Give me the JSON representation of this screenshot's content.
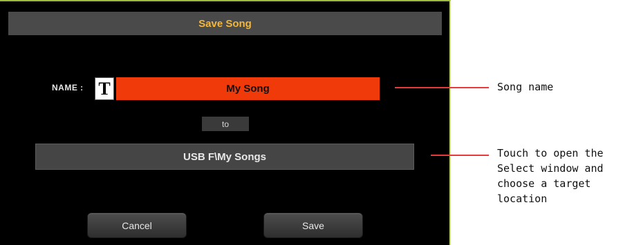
{
  "dialog": {
    "title": "Save Song",
    "name_label": "NAME :",
    "text_edit_icon": "T",
    "name_value": "My Song",
    "to_label": "to",
    "target_path": "USB F\\My Songs",
    "cancel_label": "Cancel",
    "save_label": "Save"
  },
  "callouts": {
    "song_name": "Song name",
    "target": [
      "Touch to open the",
      "Select window and",
      "choose a target",
      "location"
    ]
  },
  "colors": {
    "title_text": "#f2b73c",
    "name_field": "#f03a0a",
    "callout_line": "#e53b3b",
    "screen_border": "#c8e06a"
  }
}
